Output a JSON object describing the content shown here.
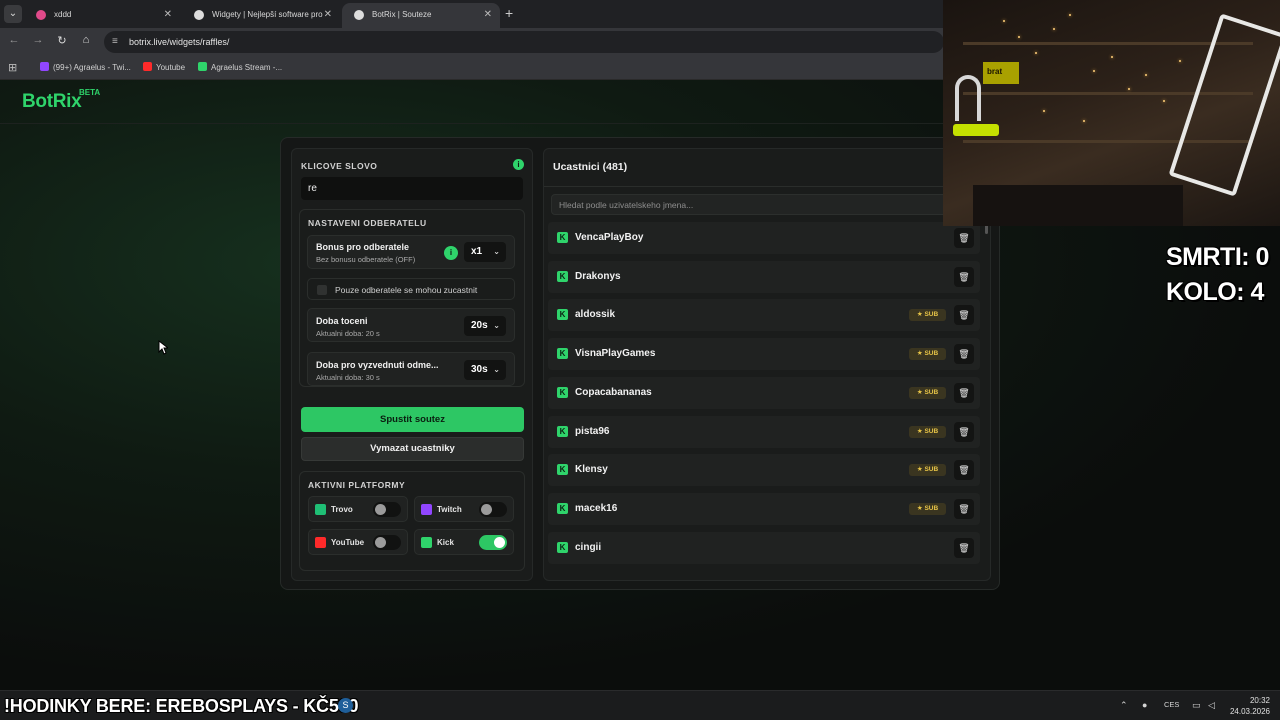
{
  "browser": {
    "tabs": [
      {
        "title": "xddd",
        "favicon_color": "#e04a8a"
      },
      {
        "title": "Widgety | Nejlepší software pro",
        "favicon_color": "#dddddd"
      },
      {
        "title": "BotRix | Souteze",
        "favicon_color": "#dddddd"
      }
    ],
    "url": "botrix.live/widgets/raffles/",
    "bookmarks": [
      {
        "label": "(99+) Agraelus - Twi...",
        "color": "#9146ff"
      },
      {
        "label": "Youtube",
        "color": "#ff2a2a"
      },
      {
        "label": "Agraelus Stream -...",
        "color": "#2fd46b"
      }
    ]
  },
  "site": {
    "logo": "BotRix",
    "logo_badge": "BETA"
  },
  "raffle": {
    "keyword_title": "KLICOVE SLOVO",
    "keyword_value": "re",
    "subscriber_settings_title": "NASTAVENI ODBERATELU",
    "bonus": {
      "title": "Bonus pro odberatele",
      "subtitle": "Bez bonusu odberatele (OFF)",
      "value": "x1"
    },
    "subs_only_label": "Pouze odberatele se mohou zucastnit",
    "spin_time": {
      "title": "Doba toceni",
      "subtitle": "Aktualni doba: 20 s",
      "value": "20s"
    },
    "claim_time": {
      "title": "Doba pro vyzvednuti odme...",
      "subtitle": "Aktualni doba: 30 s",
      "value": "30s"
    },
    "start_button": "Spustit soutez",
    "clear_button": "Vymazat ucastniky",
    "platforms_title": "AKTIVNI PLATFORMY",
    "platforms": [
      {
        "name": "Trovo",
        "enabled": false,
        "color": "#1fbf75"
      },
      {
        "name": "Twitch",
        "enabled": false,
        "color": "#9146ff"
      },
      {
        "name": "YouTube",
        "enabled": false,
        "color": "#ff2a2a"
      },
      {
        "name": "Kick",
        "enabled": true,
        "color": "#2fd46b"
      }
    ]
  },
  "participants": {
    "title": "Ucastnici (481)",
    "search_placeholder": "Hledat podle uzivatelskeho jmena...",
    "sub_badge": "SUB",
    "list": [
      {
        "name": "VencaPlayBoy",
        "sub": false
      },
      {
        "name": "Drakonys",
        "sub": false
      },
      {
        "name": "aldossik",
        "sub": true
      },
      {
        "name": "VisnaPlayGames",
        "sub": true
      },
      {
        "name": "Copacabananas",
        "sub": true
      },
      {
        "name": "pista96",
        "sub": true
      },
      {
        "name": "Klensy",
        "sub": true
      },
      {
        "name": "macek16",
        "sub": true
      },
      {
        "name": "cingii",
        "sub": false
      }
    ]
  },
  "overlay": {
    "deaths": "SMRTI: 0",
    "round": "KOLO: 4",
    "webcam_sign": "brat",
    "ticker": "!HODINKY BERE: EREBOSPLAYS - KČ500"
  },
  "taskbar": {
    "lang": "CES",
    "time": "20:32",
    "date": "24.03.2026"
  },
  "colors": {
    "accent": "#2fd46b",
    "sub_badge": "#e8c547"
  }
}
